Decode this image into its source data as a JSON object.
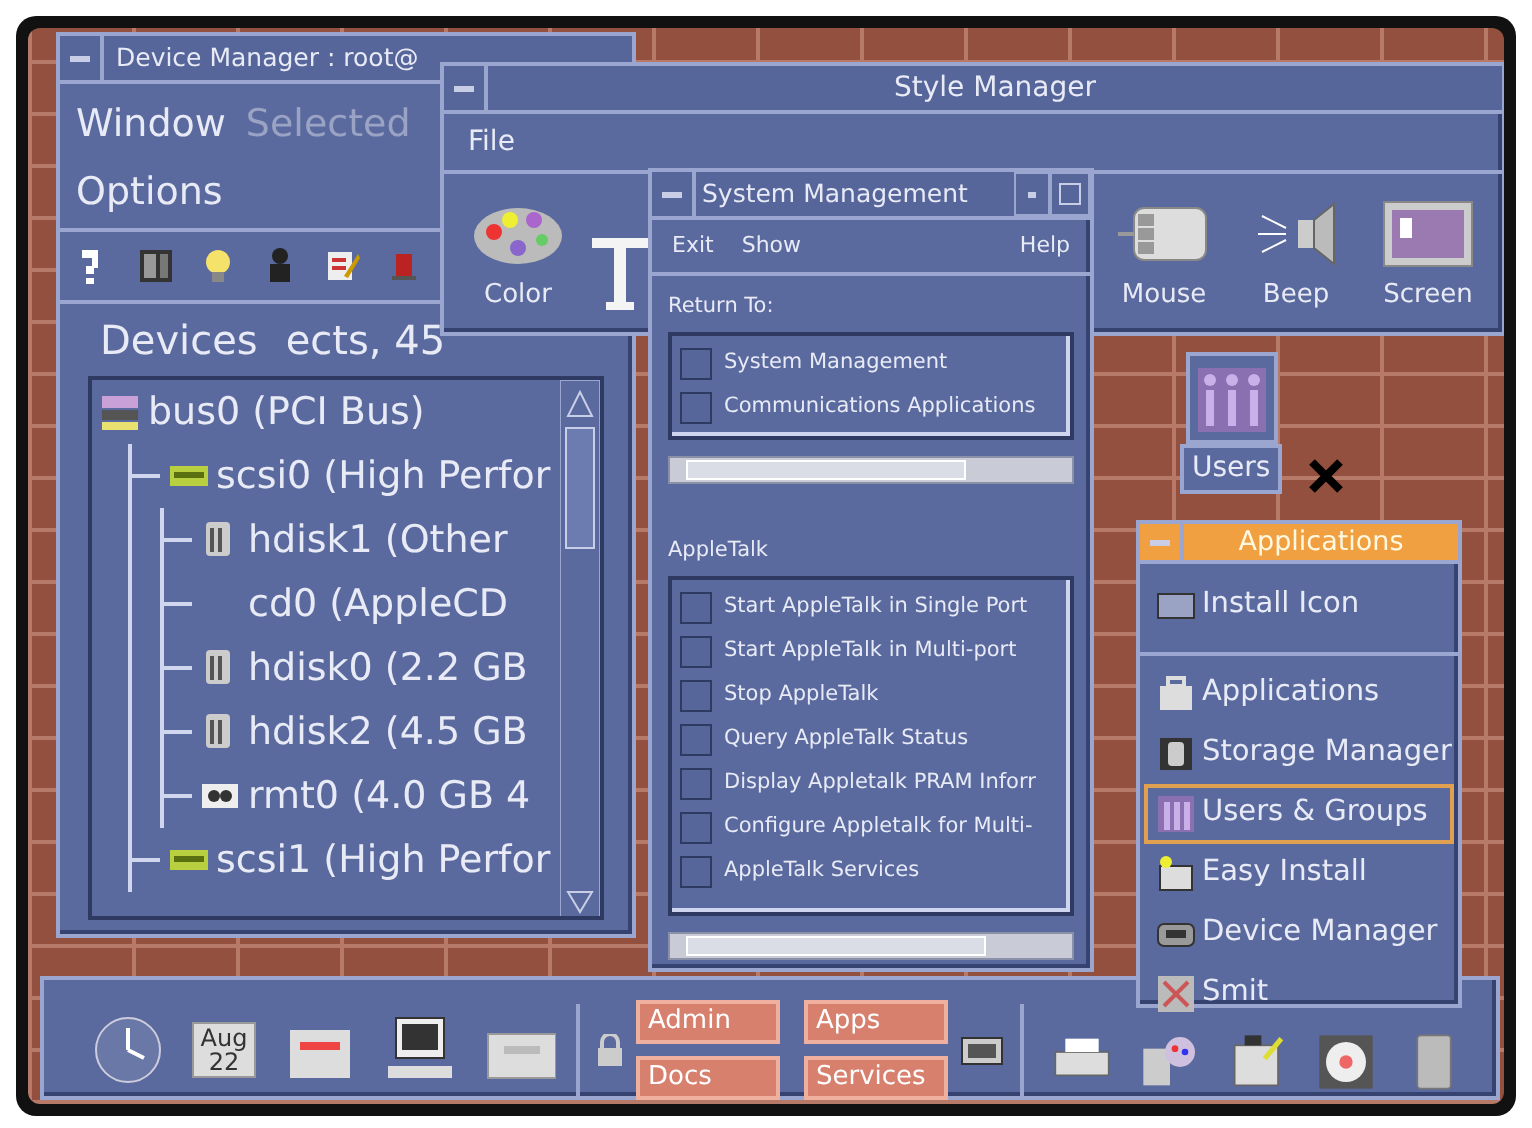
{
  "device_manager": {
    "title": "Device Manager : root@",
    "menu": [
      {
        "label": "Window",
        "disabled": false
      },
      {
        "label": "Selected",
        "disabled": true
      },
      {
        "label": "Options",
        "disabled": false
      }
    ],
    "devices_label": "Devices",
    "summary": "ects, 45",
    "tree": [
      {
        "label": "bus0 (PCI Bus)",
        "kind": "bus",
        "children": [
          {
            "label": "scsi0 (High Perfor",
            "kind": "adapter",
            "children": [
              {
                "label": "hdisk1 (Other",
                "kind": "disk"
              },
              {
                "label": "cd0 (AppleCD",
                "kind": "none"
              },
              {
                "label": "hdisk0 (2.2 GB",
                "kind": "disk"
              },
              {
                "label": "hdisk2 (4.5 GB",
                "kind": "disk"
              },
              {
                "label": "rmt0 (4.0 GB 4",
                "kind": "tape"
              }
            ]
          },
          {
            "label": "scsi1 (High Perfor",
            "kind": "adapter"
          }
        ]
      }
    ]
  },
  "style_manager": {
    "title": "Style Manager",
    "menu": [
      "File"
    ],
    "tools": [
      {
        "kind": "color",
        "label": "Color"
      },
      {
        "kind": "font"
      },
      {
        "kind": "mouse",
        "label": "Mouse"
      },
      {
        "kind": "beep",
        "label": "Beep"
      },
      {
        "kind": "screen",
        "label": "Screen"
      }
    ]
  },
  "system_management": {
    "title": "System Management",
    "menu": [
      "Exit",
      "Show",
      "Help"
    ],
    "sections": [
      {
        "heading": "Return To:",
        "items": [
          "System Management",
          "Communications Applications"
        ]
      },
      {
        "heading": "AppleTalk",
        "items": [
          "Start AppleTalk in Single Port",
          "Start AppleTalk in Multi-port",
          "Stop AppleTalk",
          "Query AppleTalk Status",
          "Display Appletalk PRAM Inforr",
          "Configure Appletalk for Multi-",
          "AppleTalk Services"
        ]
      }
    ]
  },
  "desktop_icon": {
    "label": "Users"
  },
  "applications_menu": {
    "title": "Applications",
    "groups": [
      [
        {
          "label": "Install Icon",
          "kind": "install",
          "selected": false
        }
      ],
      [
        {
          "label": "Applications",
          "kind": "apps",
          "selected": false
        },
        {
          "label": "Storage Manager",
          "kind": "storage",
          "selected": false
        },
        {
          "label": "Users & Groups",
          "kind": "users",
          "selected": true
        },
        {
          "label": "Easy Install",
          "kind": "easy",
          "selected": false
        },
        {
          "label": "Device Manager",
          "kind": "device",
          "selected": false
        },
        {
          "label": "Smit",
          "kind": "smit",
          "selected": false
        }
      ]
    ]
  },
  "front_panel": {
    "left": [
      {
        "kind": "clock"
      },
      {
        "kind": "calendar",
        "month": "Aug",
        "day": "22"
      },
      {
        "kind": "mail"
      },
      {
        "kind": "computer"
      },
      {
        "kind": "files"
      }
    ],
    "workspaces": [
      {
        "label": "Admin",
        "selected": false
      },
      {
        "label": "Apps",
        "selected": false
      },
      {
        "label": "Docs",
        "selected": false
      },
      {
        "label": "Services",
        "selected": false
      }
    ],
    "right": [
      {
        "kind": "printer"
      },
      {
        "kind": "style"
      },
      {
        "kind": "tools"
      },
      {
        "kind": "disc"
      },
      {
        "kind": "trash"
      }
    ]
  }
}
